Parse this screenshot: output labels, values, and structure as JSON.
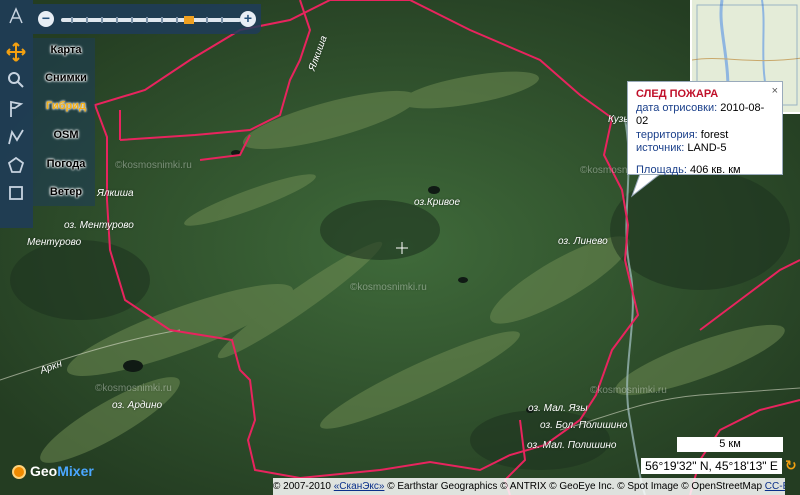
{
  "toolbar": {
    "icons": [
      "pan-icon",
      "search-icon",
      "flag-icon",
      "polyline-icon",
      "polygon-icon",
      "rectangle-icon"
    ]
  },
  "zoom": {
    "minus": "−",
    "plus": "+"
  },
  "layers": [
    {
      "label": "Карта",
      "active": false
    },
    {
      "label": "Снимки",
      "active": false
    },
    {
      "label": "Гибрид",
      "active": true
    },
    {
      "label": "OSM",
      "active": false
    },
    {
      "label": "Погода",
      "active": false
    },
    {
      "label": "Ветер",
      "active": false
    }
  ],
  "popup": {
    "title": "СЛЕД ПОЖАРА",
    "date_label": "дата отрисовки:",
    "date_value": "2010-08-02",
    "territory_label": "территория:",
    "territory_value": "forest",
    "source_label": "источник:",
    "source_value": "LAND-5",
    "area_label": "Площадь:",
    "area_value": "406 кв. км",
    "close": "×"
  },
  "map_labels": [
    {
      "text": "оз.Кривое"
    },
    {
      "text": "оз. Ментурово"
    },
    {
      "text": "Ментурово"
    },
    {
      "text": "оз. Линево"
    },
    {
      "text": "оз. Ардино"
    },
    {
      "text": "оз. Мал. Язы"
    },
    {
      "text": "оз. Бол. Полишино"
    },
    {
      "text": "оз. Мал. Полишино"
    },
    {
      "text": "Аркн"
    },
    {
      "text": "Кузь"
    },
    {
      "text": "Ялкиша"
    },
    {
      "text": "Ялкиша"
    },
    {
      "text": "©kosmosnimki.ru"
    },
    {
      "text": "©kosmosnimki.ru"
    },
    {
      "text": "©kosmosnimki.ru"
    },
    {
      "text": "©kosmosnimki.ru"
    },
    {
      "text": "©kosmosnimki.ru"
    }
  ],
  "scale": {
    "label": "5 км"
  },
  "coordinates": "56°19'32\" N, 45°18'13\" E",
  "copyright": {
    "prefix": "© 2007-2010",
    "skanex": "«СканЭкс»",
    "rest": "© Earthstar Geographics © ANTRIX © GeoEye Inc. © Spot Image © OpenStreetMap",
    "license": "CC-BY-SA"
  },
  "logo": {
    "part1": "Geo",
    "part2": "Mixer"
  },
  "colors": {
    "burn_outline": "#e8245e",
    "active_layer": "#f3b01a",
    "popup_title": "#c0102a"
  }
}
